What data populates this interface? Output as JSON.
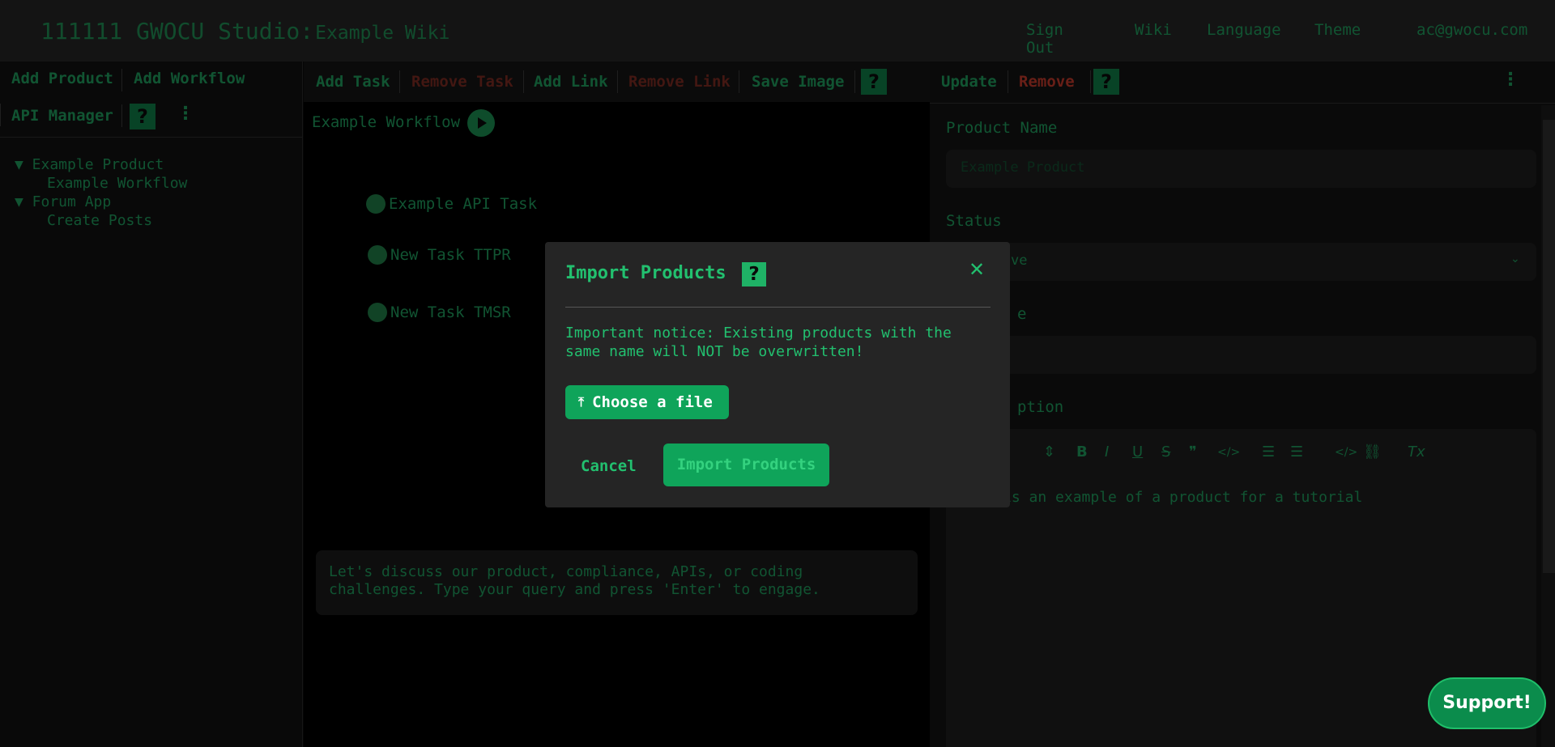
{
  "app": {
    "title_main": "111111 GWOCU Studio:",
    "title_sub": "Example Wiki"
  },
  "topnav": {
    "sign_out": "Sign Out",
    "wiki": "Wiki",
    "language": "Language",
    "theme": "Theme",
    "user": "ac@gwocu.com"
  },
  "left_toolbar": {
    "add_product": "Add Product",
    "add_workflow": "Add Workflow",
    "api_manager": "API Manager",
    "help": "?",
    "more": "⋮"
  },
  "tree": {
    "items": [
      {
        "label": "▼ Example Product"
      },
      {
        "label": "Example Workflow"
      },
      {
        "label": "▼ Forum App"
      },
      {
        "label": "Create Posts"
      }
    ]
  },
  "middle_toolbar": {
    "add_task": "Add Task",
    "remove_task": "Remove Task",
    "add_link": "Add Link",
    "remove_link": "Remove Link",
    "save_image": "Save Image",
    "help": "?"
  },
  "workflow": {
    "title": "Example Workflow",
    "tasks": [
      {
        "label": "Example API Task"
      },
      {
        "label": "New Task TTPR"
      },
      {
        "label": "New Task TMSR"
      }
    ]
  },
  "chat": {
    "placeholder": "Let's discuss our product, compliance, APIs, or coding challenges. Type your query and press 'Enter' to engage."
  },
  "right_toolbar": {
    "update": "Update",
    "remove": "Remove",
    "help": "?",
    "more": "⋮"
  },
  "product_form": {
    "name_label": "Product Name",
    "name_value": "Example Product",
    "status_label": "Status",
    "status_value": "ve",
    "third_label": "e",
    "description_label": "ption",
    "description_text": "is an example of a product for a tutorial"
  },
  "editor_toolbar": {
    "select_arrow": "⇕",
    "bold": "B",
    "italic": "I",
    "underline": "U",
    "strike": "S",
    "quote": "❞",
    "code": "</>",
    "ordered_list": "☰",
    "bullet_list": "☰",
    "code_block": "</>",
    "link": "⛓",
    "clear": "Tx"
  },
  "modal": {
    "title": "Import Products",
    "help": "?",
    "close": "✕",
    "notice": "Important notice: Existing products with the same name will NOT be overwritten!",
    "choose_file": "Choose a file",
    "upload_icon": "⤒",
    "cancel": "Cancel",
    "import": "Import Products"
  },
  "support": {
    "label": "Support!"
  },
  "colors": {
    "accent": "#22c06f",
    "button_green": "#0fa45a",
    "danger": "#c0392b",
    "background": "#0a0a0a"
  }
}
